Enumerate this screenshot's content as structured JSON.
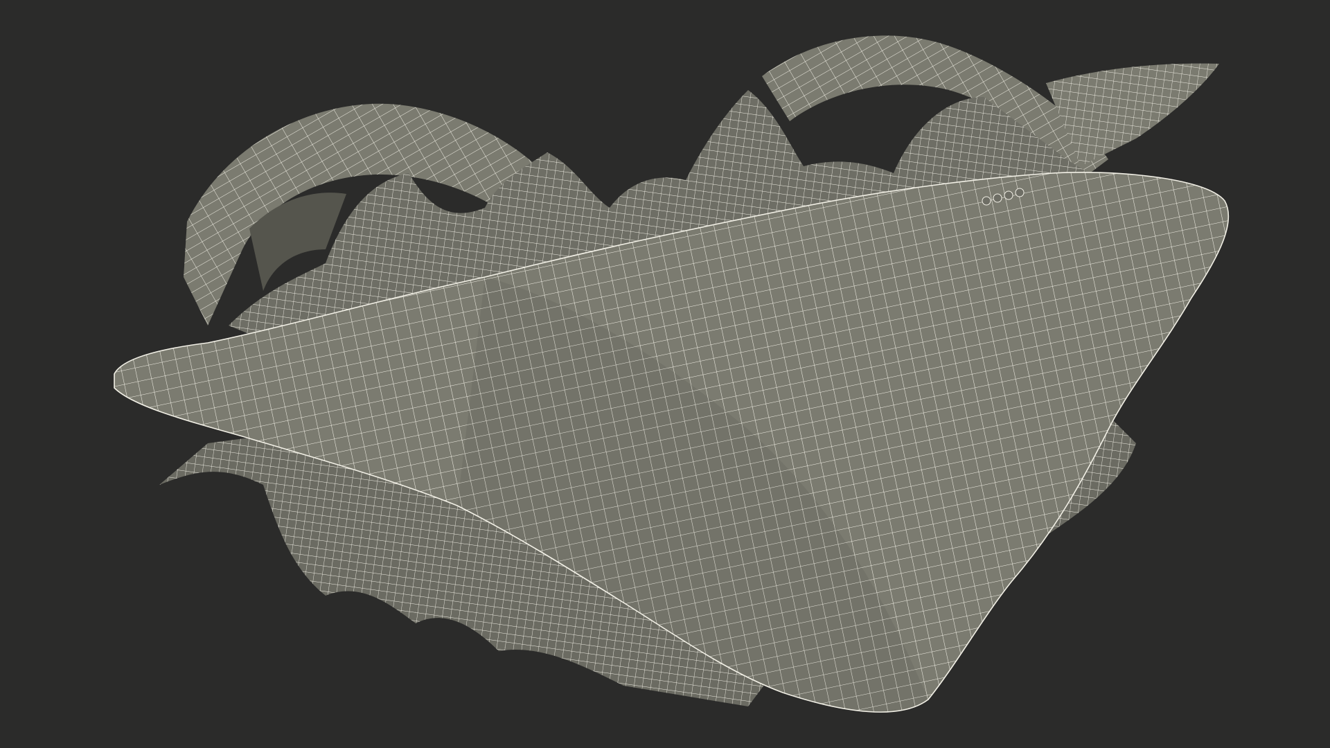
{
  "render": {
    "background_color": "#2b2b2a",
    "mesh_fill_color": "#7b7b70",
    "mesh_shadow_color": "#5f5f56",
    "wire_color": "#f2f0e6",
    "view_mode": "wireframe-on-shaded"
  },
  "subject": {
    "icon": "3d-mesh-wireframe-icon"
  }
}
